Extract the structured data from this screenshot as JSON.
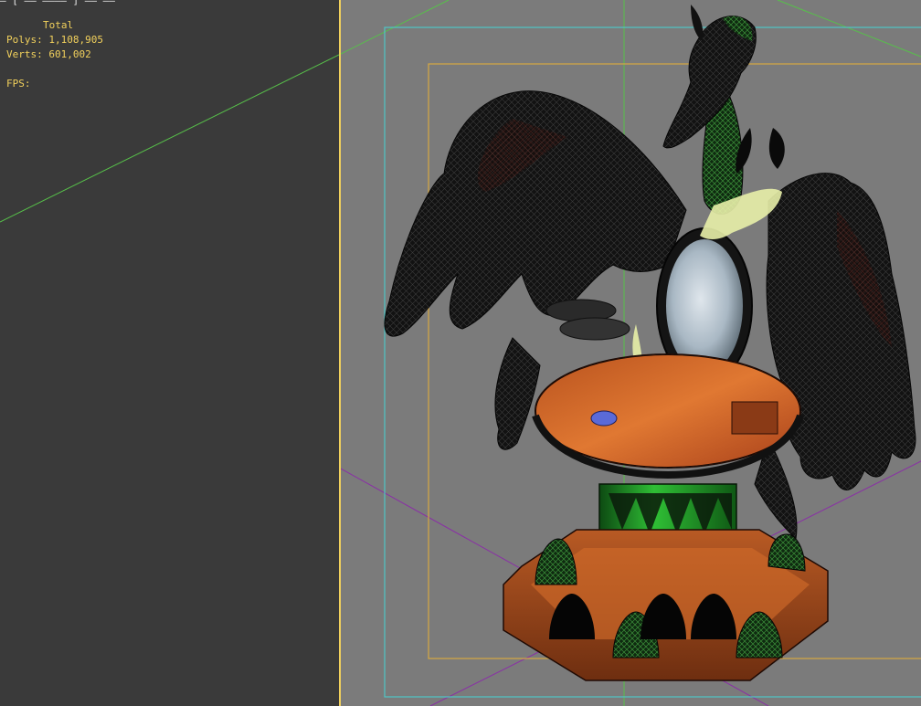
{
  "window": {
    "title_fragment": "— [ —— ———— ]  —— ——"
  },
  "stats": {
    "total_label": "Total",
    "polys_label": "Polys:",
    "polys_value": "1,108,905",
    "verts_label": "Verts:",
    "verts_value": "601,002",
    "fps_label": "FPS:"
  },
  "viewport": {
    "model": "phoenix-vanity-table",
    "colors": {
      "background": "#7b7b7b",
      "panel": "#3a3a3a",
      "stats_text": "#f2d15c",
      "safe_frame_outer": "#4fc6c6",
      "safe_frame_inner": "#d6a840",
      "grid_line_green": "#57c04a",
      "grid_line_purple": "#8a2fa6"
    }
  }
}
